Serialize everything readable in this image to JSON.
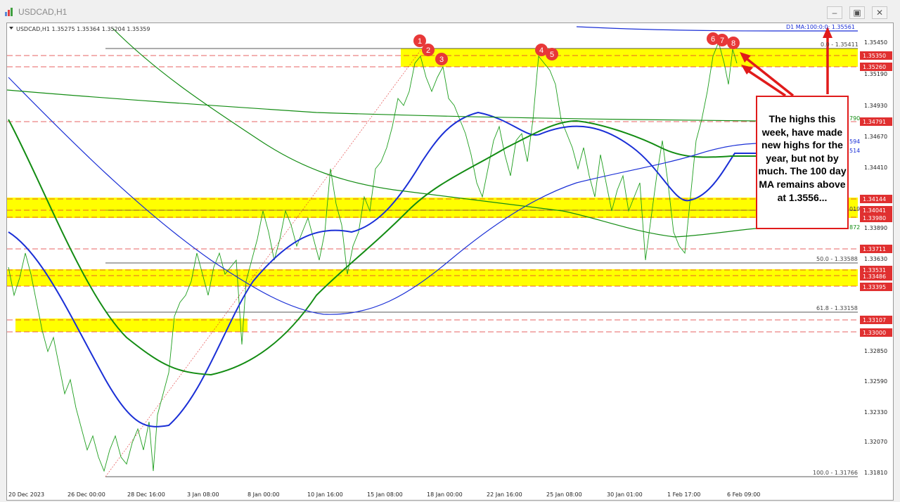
{
  "window": {
    "title": "USDCAD,H1",
    "minimize_label": "–",
    "restore_label": "▣",
    "close_label": "✕"
  },
  "chart": {
    "info_label": "USDCAD,H1  1.35275 1.35364 1.35204 1.35359",
    "ma_label": "D1 MA:100:0:0: 1.35561",
    "price_axis": [
      "1.35450",
      "1.35190",
      "1.34930",
      "1.34670",
      "1.34410",
      "1.33890",
      "1.33630",
      "1.32850",
      "1.32590",
      "1.32330",
      "1.32070",
      "1.31810"
    ],
    "price_levels": [
      {
        "text": "1.35350",
        "color": "#e03030"
      },
      {
        "text": "1.35260",
        "color": "#e03030"
      },
      {
        "text": "1.34791",
        "color": "#e03030"
      },
      {
        "text": "1.34144",
        "color": "#e03030"
      },
      {
        "text": "1.34041",
        "color": "#e03030"
      },
      {
        "text": "1.33980",
        "color": "#e03030"
      },
      {
        "text": "1.33711",
        "color": "#e03030"
      },
      {
        "text": "1.33531",
        "color": "#e03030"
      },
      {
        "text": "1.33486",
        "color": "#e03030"
      },
      {
        "text": "1.33395",
        "color": "#e03030"
      },
      {
        "text": "1.33107",
        "color": "#e03030"
      },
      {
        "text": "1.33000",
        "color": "#e03030"
      }
    ],
    "fib_labels": [
      "0.0 - 1.35411",
      "50.0 - 1.33588",
      "61.8 - 1.33158",
      "100.0 - 1.31766"
    ],
    "partial_labels": [
      "790",
      "594",
      "514",
      "019",
      "872"
    ],
    "time_axis": [
      "20 Dec 2023",
      "26 Dec 00:00",
      "28 Dec 16:00",
      "3 Jan 08:00",
      "8 Jan 00:00",
      "10 Jan 16:00",
      "15 Jan 08:00",
      "18 Jan 00:00",
      "22 Jan 16:00",
      "25 Jan 08:00",
      "30 Jan 01:00",
      "1 Feb 17:00",
      "6 Feb 09:00"
    ],
    "markers": [
      "1",
      "2",
      "3",
      "4",
      "5",
      "6",
      "7",
      "8"
    ],
    "note": "The highs this week, have made new highs for the year, but not by much. The 100 day MA remains above at 1.3556..."
  }
}
